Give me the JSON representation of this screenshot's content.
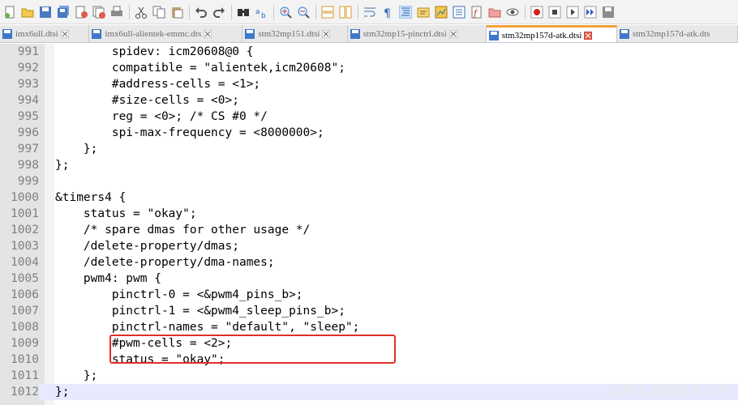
{
  "toolbar": {
    "buttons": [
      "new-file",
      "open-file",
      "save",
      "save-all",
      "close",
      "close-all",
      "print",
      "cut",
      "copy",
      "paste",
      "undo",
      "redo",
      "find",
      "replace",
      "zoom-in",
      "zoom-out",
      "sync-vertical",
      "sync-horizontal",
      "word-wrap",
      "show-all-chars",
      "indent-guide",
      "user-defined-lang",
      "doc-map",
      "function-list",
      "folder-workspace",
      "monitor",
      "record-macro",
      "stop-record",
      "play-macro",
      "run-macro-multiple",
      "save-macro"
    ]
  },
  "tabs": [
    {
      "label": "imx6ull.dtsi",
      "active": false
    },
    {
      "label": "imx6ull-alientek-emmc.dts",
      "active": false
    },
    {
      "label": "stm32mp151.dtsi",
      "active": false
    },
    {
      "label": "stm32mp15-pinctrl.dtsi",
      "active": false
    },
    {
      "label": "stm32mp157d-atk.dtsi",
      "active": true
    },
    {
      "label": "stm32mp157d-atk.dts",
      "active": false
    }
  ],
  "editor": {
    "lines": [
      {
        "num": "991",
        "code": "        spidev: icm20608@0 {"
      },
      {
        "num": "992",
        "code": "        compatible = \"alientek,icm20608\";"
      },
      {
        "num": "993",
        "code": "        #address-cells = <1>;"
      },
      {
        "num": "994",
        "code": "        #size-cells = <0>;"
      },
      {
        "num": "995",
        "code": "        reg = <0>; /* CS #0 */"
      },
      {
        "num": "996",
        "code": "        spi-max-frequency = <8000000>;"
      },
      {
        "num": "997",
        "code": "    };"
      },
      {
        "num": "998",
        "code": "};"
      },
      {
        "num": "999",
        "code": ""
      },
      {
        "num": "1000",
        "code": "&timers4 {"
      },
      {
        "num": "1001",
        "code": "    status = \"okay\";"
      },
      {
        "num": "1002",
        "code": "    /* spare dmas for other usage */"
      },
      {
        "num": "1003",
        "code": "    /delete-property/dmas;"
      },
      {
        "num": "1004",
        "code": "    /delete-property/dma-names;"
      },
      {
        "num": "1005",
        "code": "    pwm4: pwm {"
      },
      {
        "num": "1006",
        "code": "        pinctrl-0 = <&pwm4_pins_b>;"
      },
      {
        "num": "1007",
        "code": "        pinctrl-1 = <&pwm4_sleep_pins_b>;"
      },
      {
        "num": "1008",
        "code": "        pinctrl-names = \"default\", \"sleep\";"
      },
      {
        "num": "1009",
        "code": "        #pwm-cells = <2>;"
      },
      {
        "num": "1010",
        "code": "        status = \"okay\";"
      },
      {
        "num": "1011",
        "code": "    };"
      },
      {
        "num": "1012",
        "code": "};"
      }
    ],
    "current_line": "1012"
  },
  "watermark": "@稀土掘金技术社区",
  "colors": {
    "highlight_box": "#e0302a",
    "active_tab_accent": "#f1a33a",
    "current_line_bg": "#e8e8ff"
  }
}
